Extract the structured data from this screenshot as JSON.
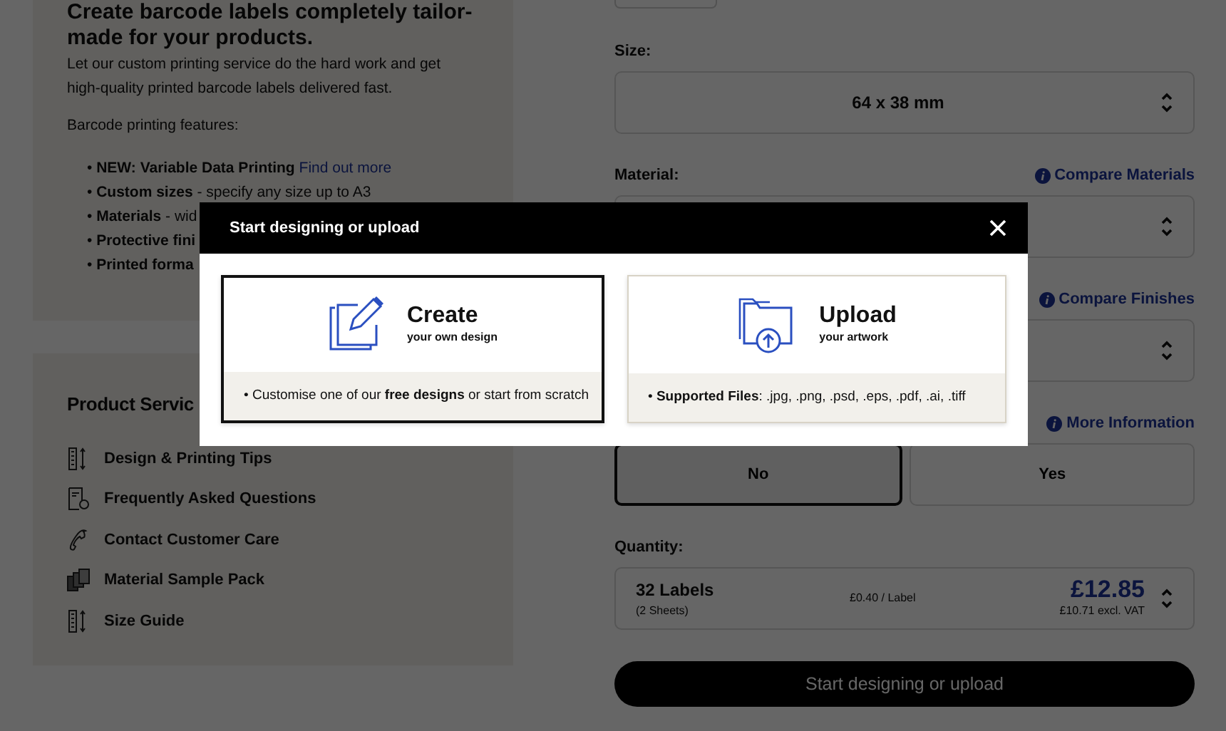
{
  "intro": {
    "heading": "Create barcode labels completely tailor-made for your products.",
    "paragraph": "Let our custom printing service do the hard work and get high-quality printed barcode labels delivered fast.",
    "features_title": "Barcode printing features:",
    "features": [
      {
        "marker": "•",
        "term": "NEW: Variable Data Printing",
        "link": "Find out more"
      },
      {
        "marker": "•",
        "term": "Custom sizes",
        "detail": "- specify any size up to A3"
      },
      {
        "marker": "•",
        "term": "Materials",
        "detail": "- wid"
      },
      {
        "marker": "•",
        "term": "Protective fini"
      },
      {
        "marker": "•",
        "term": "Printed forma"
      }
    ]
  },
  "services": {
    "title": "Product Servic",
    "items": [
      {
        "kind": "ruler",
        "label": "Design & Printing Tips"
      },
      {
        "kind": "document",
        "label": "Frequently Asked Questions"
      },
      {
        "kind": "phone",
        "label": "Contact Customer Care"
      },
      {
        "kind": "samples",
        "label": "Material Sample Pack"
      },
      {
        "kind": "ruler",
        "label": "Size Guide"
      }
    ]
  },
  "form": {
    "size": {
      "label": "Size:",
      "value": "64 x 38 mm"
    },
    "material": {
      "label": "Material:",
      "link": "Compare Materials"
    },
    "finish": {
      "link": "Compare Finishes"
    },
    "option": {
      "link": "More Information",
      "choices": [
        {
          "label": "No",
          "selected": true
        },
        {
          "label": "Yes",
          "selected": false
        }
      ]
    },
    "quantity": {
      "label": "Quantity:",
      "labels": "32 Labels",
      "sheets": "(2 Sheets)",
      "unit_price": "£0.40 / Label",
      "price": "£12.85",
      "price_ex_vat": "£10.71 excl. VAT"
    },
    "submit": "Start designing or upload"
  },
  "modal": {
    "title": "Start designing or upload",
    "options": [
      {
        "kind": "create",
        "title": "Create",
        "subtitle": "your own design",
        "note": "• Customise one of our **free designs** or start from scratch",
        "selected": true
      },
      {
        "kind": "upload",
        "title": "Upload",
        "subtitle": "your artwork",
        "note": "• **Supported Files**: .jpg, .png, .psd, .eps, .pdf, .ai, .tiff",
        "selected": false
      }
    ]
  }
}
